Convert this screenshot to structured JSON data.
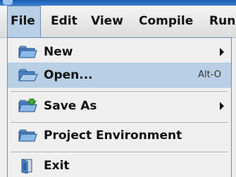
{
  "menubar": {
    "menus": [
      {
        "label": "File"
      },
      {
        "label": "Edit"
      },
      {
        "label": "View"
      },
      {
        "label": "Compile"
      },
      {
        "label": "Run"
      }
    ],
    "active_menu": "File"
  },
  "file_menu": {
    "items": [
      {
        "label": "New",
        "icon": "folder-icon",
        "submenu": true
      },
      {
        "label": "Open...",
        "icon": "open-folder-icon",
        "accelerator": "Alt-O",
        "selected": true
      },
      {
        "label": "Save As",
        "icon": "save-folder-icon",
        "submenu": true
      },
      {
        "label": "Project Environment",
        "icon": "project-folder-icon"
      },
      {
        "label": "Exit",
        "icon": "exit-door-icon"
      }
    ]
  },
  "colors": {
    "selection": "#b8cfe5",
    "menu_background": "#efefef",
    "titlebar": "#1a5fb4"
  }
}
